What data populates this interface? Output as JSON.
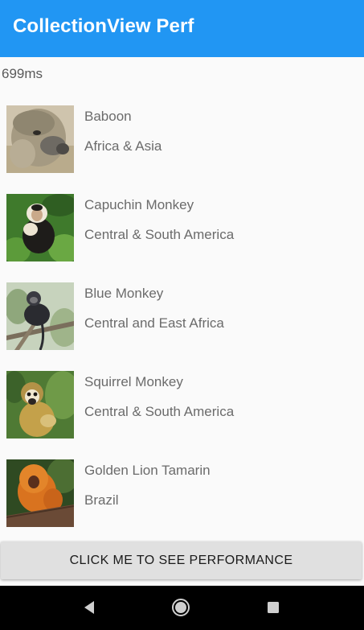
{
  "app": {
    "title": "CollectionView Perf"
  },
  "timing": {
    "value": "699ms"
  },
  "monkeys": [
    {
      "name": "Baboon",
      "location": "Africa & Asia"
    },
    {
      "name": "Capuchin Monkey",
      "location": "Central & South America"
    },
    {
      "name": "Blue Monkey",
      "location": "Central and East Africa"
    },
    {
      "name": "Squirrel Monkey",
      "location": "Central & South America"
    },
    {
      "name": "Golden Lion Tamarin",
      "location": "Brazil"
    }
  ],
  "button": {
    "label": "CLICK ME TO SEE PERFORMANCE"
  },
  "navigation": {
    "back_icon": "back-triangle-icon",
    "home_icon": "home-circle-icon",
    "recent_icon": "recent-square-icon"
  },
  "colors": {
    "app_bar": "#2196f3",
    "background": "#fafafa",
    "button": "#e0e0e0",
    "nav_bar": "#000000"
  }
}
